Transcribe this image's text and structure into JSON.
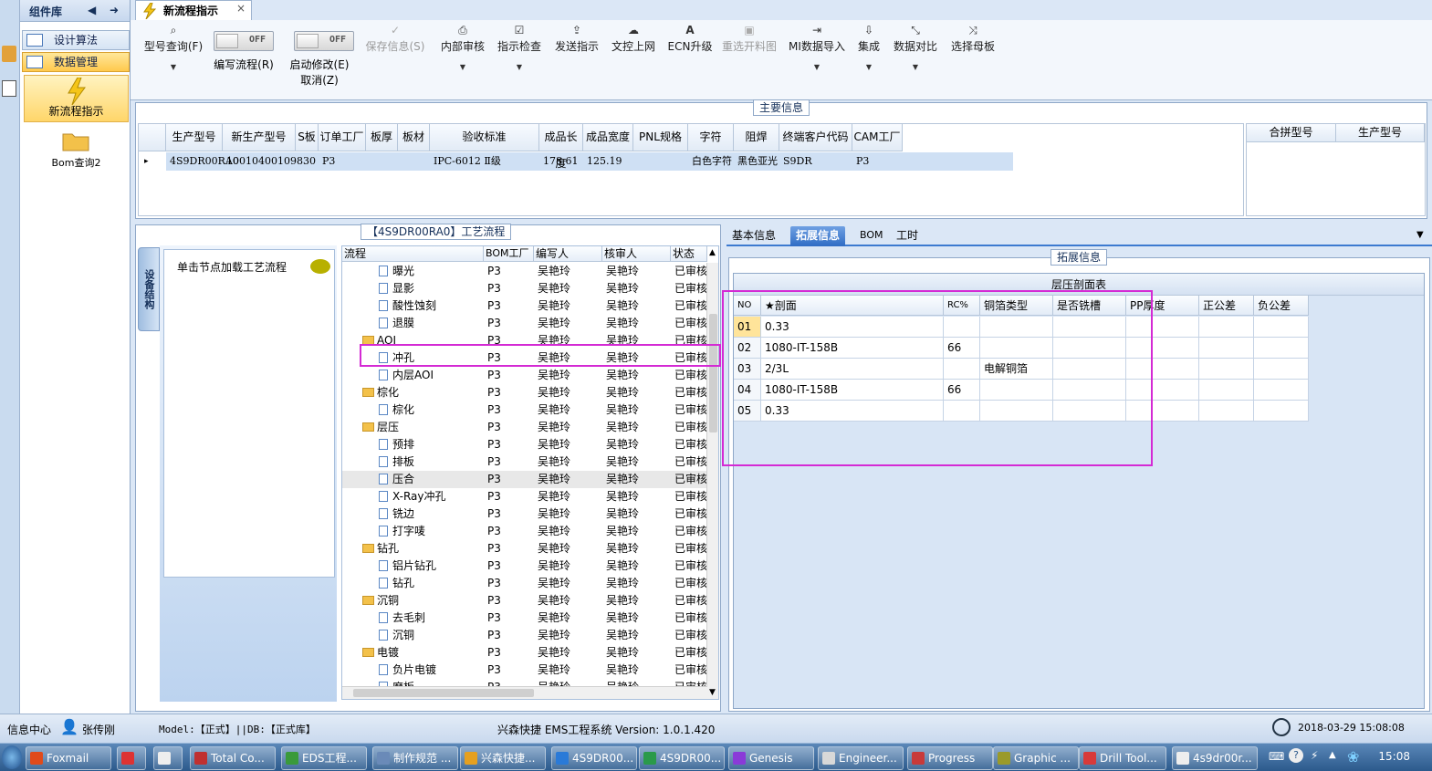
{
  "sidebar": {
    "header": "组件库",
    "items": [
      {
        "label": "设计算法"
      },
      {
        "label": "数据管理"
      }
    ],
    "nav_flow": "新流程指示",
    "nav_bom": "Bom查询2"
  },
  "tab": {
    "title": "新流程指示",
    "close": "×"
  },
  "toolbar": {
    "model_query": "型号查询(F)",
    "write_flow": "编写流程(R)",
    "start_modify_1": "启动修改(E)",
    "start_modify_2": "取消(Z)",
    "toggle_off": "OFF",
    "save_info": "保存信息(S)",
    "internal_review": "内部审核",
    "instruction_check": "指示检查",
    "send_instruction": "发送指示",
    "upload_web": "文控上网",
    "ecn_upgrade": "ECN升级",
    "reselect_chart": "重选开料图",
    "mi_import": "MI数据导入",
    "integrate": "集成",
    "data_compare": "数据对比",
    "select_mother": "选择母板"
  },
  "main_info": {
    "title": "主要信息",
    "columns": [
      "生产型号",
      "新生产型号",
      "S板",
      "订单工厂",
      "板厚",
      "板材",
      "验收标准",
      "成品长度",
      "成品宽度",
      "PNL规格",
      "字符",
      "阻焊",
      "终端客户代码",
      "CAM工厂"
    ],
    "row": [
      "4S9DR00RA0",
      "10010400109830",
      "",
      "P3",
      "",
      "",
      "IPC-6012 Ⅱ级",
      "178.61",
      "125.19",
      "",
      "白色字符",
      "黑色亚光",
      "S9DR",
      "P3"
    ],
    "merge_columns": [
      "合拼型号",
      "生产型号"
    ]
  },
  "process": {
    "title": "【4S9DR00RA0】工艺流程",
    "vtab": "设备结构",
    "note": "单击节点加载工艺流程",
    "columns": [
      "流程",
      "BOM工厂",
      "编写人",
      "核审人",
      "状态"
    ],
    "rows": [
      {
        "name": "曝光",
        "level": 2,
        "folder": false,
        "bom": "P3",
        "writer": "吴艳玲",
        "reviewer": "吴艳玲",
        "status": "已审核"
      },
      {
        "name": "显影",
        "level": 2,
        "folder": false,
        "bom": "P3",
        "writer": "吴艳玲",
        "reviewer": "吴艳玲",
        "status": "已审核"
      },
      {
        "name": "酸性蚀刻",
        "level": 2,
        "folder": false,
        "bom": "P3",
        "writer": "吴艳玲",
        "reviewer": "吴艳玲",
        "status": "已审核"
      },
      {
        "name": "退膜",
        "level": 2,
        "folder": false,
        "bom": "P3",
        "writer": "吴艳玲",
        "reviewer": "吴艳玲",
        "status": "已审核"
      },
      {
        "name": "AOI",
        "level": 1,
        "folder": true,
        "bom": "P3",
        "writer": "吴艳玲",
        "reviewer": "吴艳玲",
        "status": "已审核"
      },
      {
        "name": "冲孔",
        "level": 2,
        "folder": false,
        "bom": "P3",
        "writer": "吴艳玲",
        "reviewer": "吴艳玲",
        "status": "已审核"
      },
      {
        "name": "内层AOI",
        "level": 2,
        "folder": false,
        "bom": "P3",
        "writer": "吴艳玲",
        "reviewer": "吴艳玲",
        "status": "已审核"
      },
      {
        "name": "棕化",
        "level": 1,
        "folder": true,
        "bom": "P3",
        "writer": "吴艳玲",
        "reviewer": "吴艳玲",
        "status": "已审核"
      },
      {
        "name": "棕化",
        "level": 2,
        "folder": false,
        "bom": "P3",
        "writer": "吴艳玲",
        "reviewer": "吴艳玲",
        "status": "已审核"
      },
      {
        "name": "层压",
        "level": 1,
        "folder": true,
        "bom": "P3",
        "writer": "吴艳玲",
        "reviewer": "吴艳玲",
        "status": "已审核"
      },
      {
        "name": "预排",
        "level": 2,
        "folder": false,
        "bom": "P3",
        "writer": "吴艳玲",
        "reviewer": "吴艳玲",
        "status": "已审核"
      },
      {
        "name": "排板",
        "level": 2,
        "folder": false,
        "bom": "P3",
        "writer": "吴艳玲",
        "reviewer": "吴艳玲",
        "status": "已审核"
      },
      {
        "name": "压合",
        "level": 2,
        "folder": false,
        "bom": "P3",
        "writer": "吴艳玲",
        "reviewer": "吴艳玲",
        "status": "已审核",
        "selected": true
      },
      {
        "name": "X-Ray冲孔",
        "level": 2,
        "folder": false,
        "bom": "P3",
        "writer": "吴艳玲",
        "reviewer": "吴艳玲",
        "status": "已审核"
      },
      {
        "name": "铣边",
        "level": 2,
        "folder": false,
        "bom": "P3",
        "writer": "吴艳玲",
        "reviewer": "吴艳玲",
        "status": "已审核"
      },
      {
        "name": "打字唛",
        "level": 2,
        "folder": false,
        "bom": "P3",
        "writer": "吴艳玲",
        "reviewer": "吴艳玲",
        "status": "已审核"
      },
      {
        "name": "钻孔",
        "level": 1,
        "folder": true,
        "bom": "P3",
        "writer": "吴艳玲",
        "reviewer": "吴艳玲",
        "status": "已审核"
      },
      {
        "name": "铝片钻孔",
        "level": 2,
        "folder": false,
        "bom": "P3",
        "writer": "吴艳玲",
        "reviewer": "吴艳玲",
        "status": "已审核"
      },
      {
        "name": "钻孔",
        "level": 2,
        "folder": false,
        "bom": "P3",
        "writer": "吴艳玲",
        "reviewer": "吴艳玲",
        "status": "已审核"
      },
      {
        "name": "沉铜",
        "level": 1,
        "folder": true,
        "bom": "P3",
        "writer": "吴艳玲",
        "reviewer": "吴艳玲",
        "status": "已审核"
      },
      {
        "name": "去毛刺",
        "level": 2,
        "folder": false,
        "bom": "P3",
        "writer": "吴艳玲",
        "reviewer": "吴艳玲",
        "status": "已审核"
      },
      {
        "name": "沉铜",
        "level": 2,
        "folder": false,
        "bom": "P3",
        "writer": "吴艳玲",
        "reviewer": "吴艳玲",
        "status": "已审核"
      },
      {
        "name": "电镀",
        "level": 1,
        "folder": true,
        "bom": "P3",
        "writer": "吴艳玲",
        "reviewer": "吴艳玲",
        "status": "已审核"
      },
      {
        "name": "负片电镀",
        "level": 2,
        "folder": false,
        "bom": "P3",
        "writer": "吴艳玲",
        "reviewer": "吴艳玲",
        "status": "已审核"
      },
      {
        "name": "磨板",
        "level": 2,
        "folder": false,
        "bom": "P3",
        "writer": "吴艳玲",
        "reviewer": "吴艳玲",
        "status": "已审核"
      }
    ]
  },
  "right_tabs": [
    "基本信息",
    "拓展信息",
    "BOM",
    "工时"
  ],
  "ext": {
    "title": "拓展信息",
    "table_title": "层压剖面表",
    "columns": [
      "NO",
      "★剖面",
      "RC%",
      "铜箔类型",
      "是否铣槽",
      "PP厚度",
      "正公差",
      "负公差"
    ],
    "rows": [
      [
        "01",
        "0.33",
        "",
        "",
        "",
        "",
        "",
        ""
      ],
      [
        "02",
        "1080-IT-158B",
        "66",
        "",
        "",
        "",
        "",
        ""
      ],
      [
        "03",
        "2/3L",
        "",
        "电解铜箔",
        "",
        "",
        "",
        ""
      ],
      [
        "04",
        "1080-IT-158B",
        "66",
        "",
        "",
        "",
        "",
        ""
      ],
      [
        "05",
        "0.33",
        "",
        "",
        "",
        "",
        "",
        ""
      ]
    ]
  },
  "status": {
    "info_center": "信息中心",
    "user": "张传刚",
    "model": "Model:【正式】||DB:【正式库】",
    "system": "兴森快捷 EMS工程系统 Version: 1.0.1.420",
    "datetime": "2018-03-29 15:08:08"
  },
  "taskbar": {
    "items": [
      "Foxmail",
      "",
      "",
      "Total Co...",
      "EDS工程...",
      "制作规范 ...",
      "兴森快捷...",
      "4S9DR00...",
      "4S9DR00...",
      "Genesis",
      "Engineer...",
      "Progress",
      "Graphic ...",
      "Drill Tool...",
      "4s9dr00r..."
    ],
    "clock": "15:08"
  },
  "colors": {
    "highlight": "#d42ad4",
    "selection": "#cfe0f4",
    "active_tab": "#2f6cc4"
  }
}
